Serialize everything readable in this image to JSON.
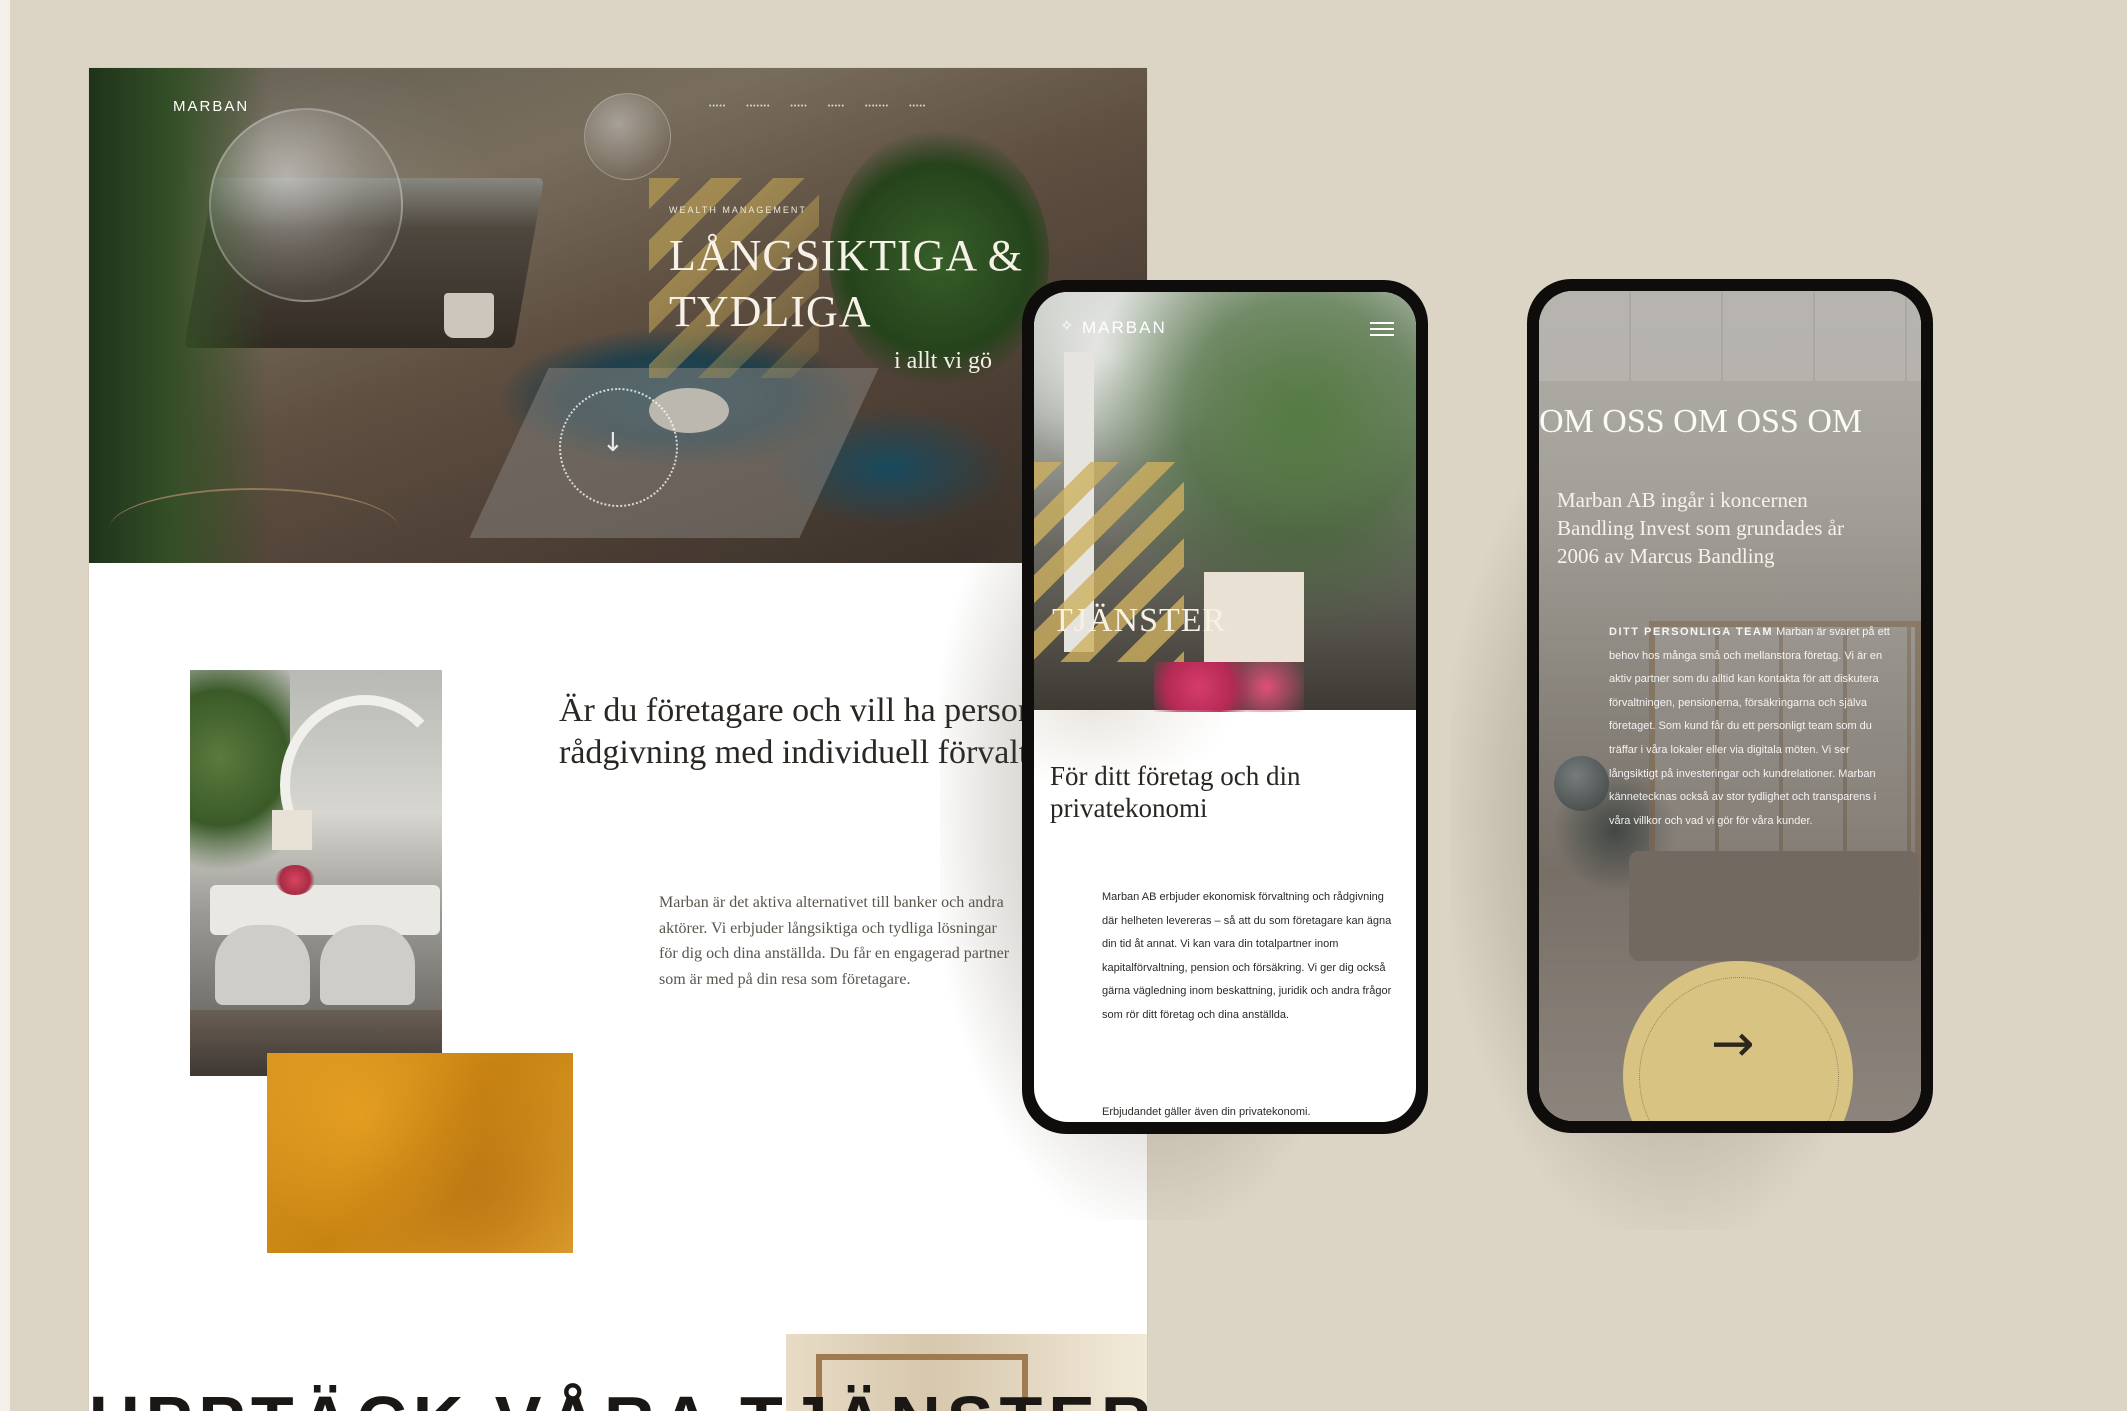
{
  "desktop": {
    "logo": "MARBAN",
    "nav": [
      "•••••",
      "•••••••",
      "•••••",
      "•••••",
      "•••••••",
      "•••••"
    ],
    "hero": {
      "eyebrow": "WEALTH MANAGEMENT",
      "title_line1": "LÅNGSIKTIGA &",
      "title_line2": "TYDLIGA",
      "subtitle": "i allt vi gö"
    },
    "about": {
      "heading": "Är du företagare och vill ha personlig rådgivning med individuell förvaltning?",
      "body": "Marban är det aktiva alternativet till banker och andra aktörer. Vi erbjuder långsiktiga och tydliga lösningar för dig och dina anställda. Du får en engagerad partner som är med på din resa som företagare."
    },
    "bottom_heading": "UPPTÄCK VÅRA TJÄNSTER"
  },
  "phone1": {
    "logo": "MARBAN",
    "logo_mark": "✧",
    "hero_title": "TJÄNSTER",
    "heading": "För ditt företag och din privatekonomi",
    "body": "Marban AB erbjuder ekonomisk förvaltning och rådgivning där helheten levereras – så att du som företagare kan ägna din tid åt annat. Vi kan vara din totalpartner inom kapitalförvaltning, pension och försäkring. Vi ger dig också gärna vägledning inom beskattning, juridik och andra frågor som rör ditt företag och dina anställda.",
    "body2": "Erbjudandet gäller även din privatekonomi."
  },
  "phone2": {
    "title": "OM OSS OM OSS OM",
    "body": "Marban AB ingår i koncernen Bandling Invest som grundades år 2006 av Marcus Bandling",
    "team_label": "DITT PERSONLIGA TEAM",
    "team_text": " Marban är svaret på ett behov hos många små och mellanstora företag. Vi är en aktiv partner som du alltid kan kontakta för att diskutera förvaltningen, pensionerna, försäkringarna och själva företaget. Som kund får du ett personligt team som du träffar i våra lokaler eller via digitala möten. Vi ser långsiktigt på investeringar och kundrelationer. Marban kännetecknas också av stor tydlighet och transparens i våra villkor och vad vi gör för våra kunder.",
    "arrow": "→"
  },
  "colors": {
    "background": "#dcd5c6",
    "gold": "#d8c383",
    "accent_orange": "#d99520",
    "text_dark": "#2a2622"
  },
  "icons": [
    "hamburger-menu-icon",
    "arrow-right-icon",
    "arrow-down-icon",
    "logo-mark-icon"
  ]
}
